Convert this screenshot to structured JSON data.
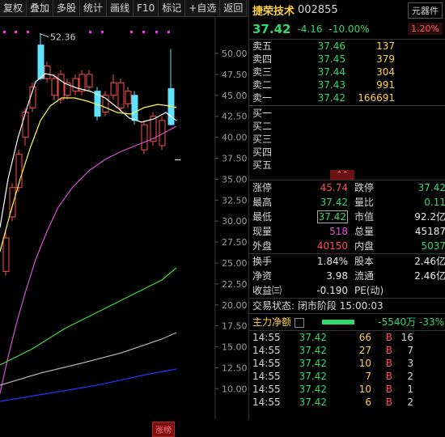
{
  "toolbar": {
    "buttons": [
      "复权",
      "叠加",
      "多股",
      "统计",
      "画线",
      "F10",
      "标记",
      "+自选",
      "返回"
    ]
  },
  "chart": {
    "y_axis_labels": [
      "50.00",
      "47.50",
      "45.00",
      "42.50",
      "40.00",
      "37.50",
      "35.00",
      "32.50",
      "30.00",
      "27.50",
      "25.00",
      "22.50",
      "20.00",
      "17.50",
      "15.00",
      "12.50",
      "10.00"
    ],
    "high_marker": "52.36",
    "bottom_tag": "涨榜"
  },
  "quote": {
    "name": "捷荣技术",
    "code": "002855",
    "industry": "元器件",
    "industry_pct": "1.20%",
    "price": "37.42",
    "change": "-4.16",
    "change_pct": "-10.00%"
  },
  "sell_book": [
    {
      "label": "卖五",
      "price": "37.46",
      "vol": "137"
    },
    {
      "label": "卖四",
      "price": "37.45",
      "vol": "379"
    },
    {
      "label": "卖三",
      "price": "37.44",
      "vol": "304"
    },
    {
      "label": "卖二",
      "price": "37.43",
      "vol": "991"
    },
    {
      "label": "卖一",
      "price": "37.42",
      "vol": "166691"
    }
  ],
  "buy_book": [
    {
      "label": "买一",
      "price": "",
      "vol": ""
    },
    {
      "label": "买二",
      "price": "",
      "vol": ""
    },
    {
      "label": "买三",
      "price": "",
      "vol": ""
    },
    {
      "label": "买四",
      "price": "",
      "vol": ""
    },
    {
      "label": "买五",
      "price": "",
      "vol": ""
    }
  ],
  "stats": {
    "limit_up_k": "涨停",
    "limit_up_v": "45.74",
    "limit_down_k": "跌停",
    "limit_down_v": "37.42",
    "high_k": "最高",
    "high_v": "37.42",
    "vol_ratio_k": "量比",
    "vol_ratio_v": "0.11",
    "low_k": "最低",
    "low_v": "37.42",
    "mktcap_k": "市值",
    "mktcap_v": "92.2亿",
    "cur_vol_k": "现量",
    "cur_vol_v": "518",
    "total_vol_k": "总量",
    "total_vol_v": "45187",
    "outer_k": "外盘",
    "outer_v": "40150",
    "inner_k": "内盘",
    "inner_v": "5037",
    "turnover_k": "换手",
    "turnover_v": "1.84%",
    "shares_k": "股本",
    "shares_v": "2.46亿",
    "nav_k": "净资",
    "nav_v": "3.98",
    "float_k": "流通",
    "float_v": "2.46亿",
    "eps_k": "收益㈢",
    "eps_v": "-0.190",
    "pe_k": "PE(动)",
    "pe_v": ""
  },
  "status": {
    "label": "交易状态:",
    "value": "闭市阶段 15:00:03"
  },
  "net_flow": {
    "label": "主力净额",
    "value": "-5540万 -33%"
  },
  "ticks": [
    {
      "t": "14:55",
      "p": "37.42",
      "vol": "66",
      "bs": "B",
      "n": "16"
    },
    {
      "t": "14:55",
      "p": "37.42",
      "vol": "27",
      "bs": "B",
      "n": "7"
    },
    {
      "t": "14:55",
      "p": "37.42",
      "vol": "10",
      "bs": "B",
      "n": "3"
    },
    {
      "t": "14:55",
      "p": "37.42",
      "vol": "7",
      "bs": "B",
      "n": "2"
    },
    {
      "t": "14:55",
      "p": "37.42",
      "vol": "10",
      "bs": "B",
      "n": "1"
    },
    {
      "t": "14:55",
      "p": "37.42",
      "vol": "6",
      "bs": "B",
      "n": "2"
    }
  ],
  "colors": {
    "up": "#ff4d4d",
    "down": "#2fd96a",
    "cyan_candle": "#5fe3ff",
    "ma5": "#ffffff",
    "ma10": "#ffff55",
    "ma20": "#e14be1",
    "ma60": "#3ee23e",
    "ma120": "#b0b0b0",
    "ma250": "#2233ff"
  }
}
